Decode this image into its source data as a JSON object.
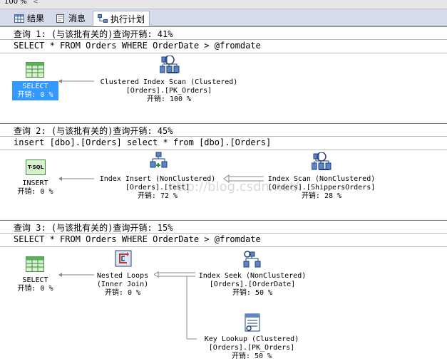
{
  "topbar": {
    "zoom": "100 %",
    "caret": "<"
  },
  "tabs": [
    {
      "label": "结果",
      "icon": "grid-icon"
    },
    {
      "label": "消息",
      "icon": "message-icon"
    },
    {
      "label": "执行计划",
      "icon": "execution-plan-icon"
    }
  ],
  "queries": [
    {
      "header": "查询 1: (与该批有关的)查询开销: 41%",
      "sql": "SELECT * FROM Orders WHERE OrderDate > @fromdate",
      "ops": {
        "select": {
          "name": "SELECT",
          "cost": "开销: 0 %"
        },
        "scan": {
          "name": "Clustered Index Scan (Clustered)",
          "object": "[Orders].[PK_Orders]",
          "cost": "开销: 100 %"
        }
      }
    },
    {
      "header": "查询 2: (与该批有关的)查询开销: 45%",
      "sql": "insert [dbo].[Orders] select * from [dbo].[Orders]",
      "ops": {
        "insert": {
          "name": "INSERT",
          "cost": "开销: 0 %",
          "icon_text": "T-SQL"
        },
        "index_insert": {
          "name": "Index Insert (NonClustered)",
          "object": "[Orders].[test]",
          "cost": "开销: 72 %"
        },
        "index_scan": {
          "name": "Index Scan (NonClustered)",
          "object": "[Orders].[ShippersOrders]",
          "cost": "开销: 28 %"
        }
      }
    },
    {
      "header": "查询 3: (与该批有关的)查询开销: 15%",
      "sql": "SELECT * FROM Orders WHERE OrderDate > @fromdate",
      "ops": {
        "select": {
          "name": "SELECT",
          "cost": "开销: 0 %"
        },
        "nested_loops": {
          "name": "Nested Loops",
          "sub": "(Inner Join)",
          "cost": "开销: 0 %"
        },
        "index_seek": {
          "name": "Index Seek (NonClustered)",
          "object": "[Orders].[OrderDate]",
          "cost": "开销: 50 %"
        },
        "key_lookup": {
          "name": "Key Lookup (Clustered)",
          "object": "[Orders].[PK_Orders]",
          "cost": "开销: 50 %"
        }
      }
    }
  ],
  "watermark": "http://blog.csdn.net/"
}
